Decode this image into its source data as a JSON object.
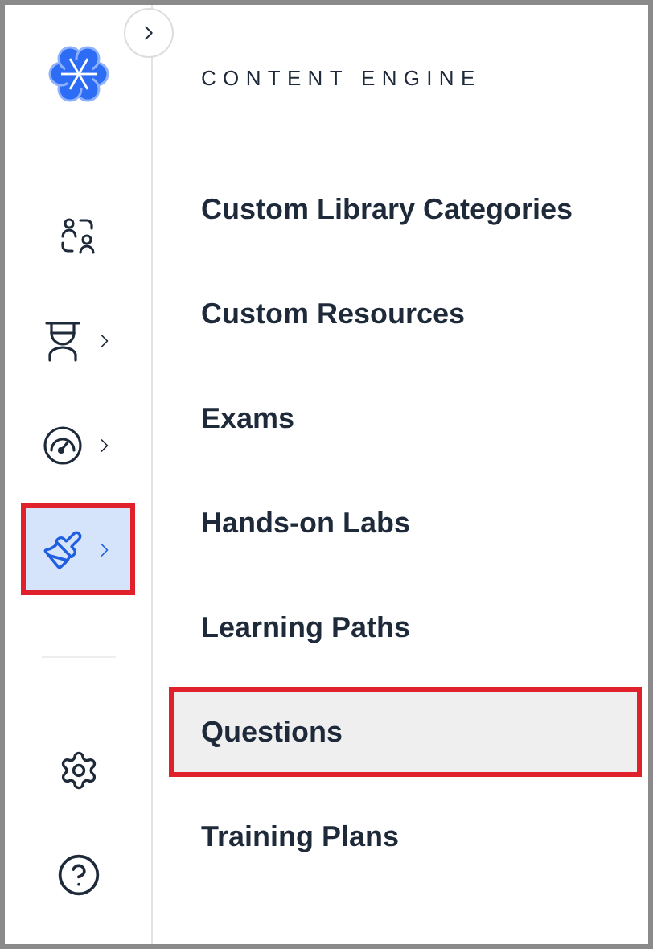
{
  "rail": {
    "items": [
      {
        "kind": "people",
        "has_submenu": false,
        "selected": false
      },
      {
        "kind": "presenter",
        "has_submenu": true,
        "selected": false
      },
      {
        "kind": "gauge",
        "has_submenu": true,
        "selected": false
      },
      {
        "kind": "brush",
        "has_submenu": true,
        "selected": true
      }
    ],
    "footer": [
      {
        "kind": "settings"
      },
      {
        "kind": "help"
      }
    ]
  },
  "menu": {
    "heading": "CONTENT ENGINE",
    "items": [
      {
        "label": "Custom Library Categories",
        "selected": false
      },
      {
        "label": "Custom Resources",
        "selected": false
      },
      {
        "label": "Exams",
        "selected": false
      },
      {
        "label": "Hands-on Labs",
        "selected": false
      },
      {
        "label": "Learning Paths",
        "selected": false
      },
      {
        "label": "Questions",
        "selected": true
      },
      {
        "label": "Training Plans",
        "selected": false
      }
    ]
  }
}
